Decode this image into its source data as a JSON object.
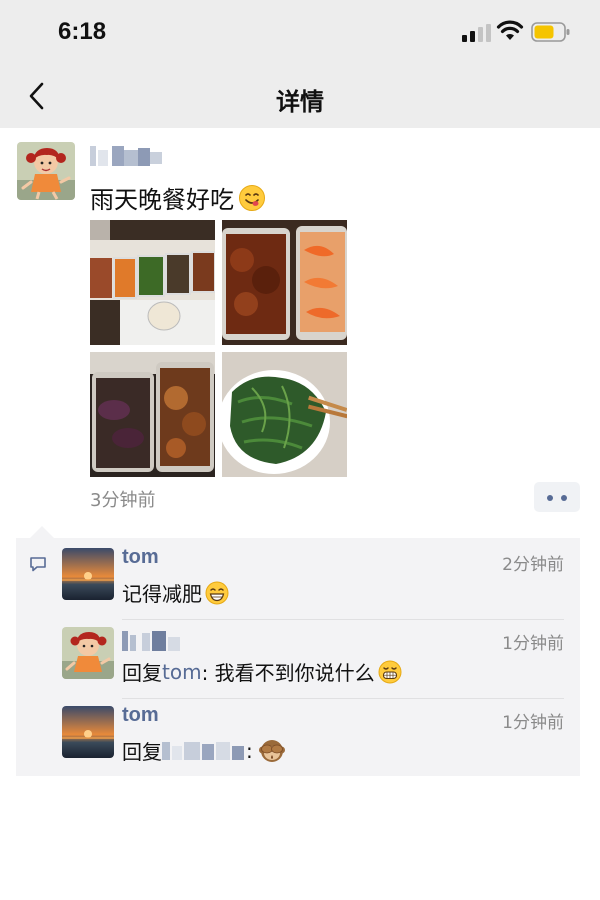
{
  "status_bar": {
    "time": "6:18"
  },
  "nav": {
    "title": "详情",
    "back_icon": "chevron-left-icon"
  },
  "post": {
    "text": "雨天晚餐好吃",
    "emoji": "yum-face",
    "time": "3分钟前",
    "photos": [
      "dinner-photo-1",
      "dinner-photo-2",
      "dinner-photo-3",
      "dinner-photo-4"
    ]
  },
  "comments": [
    {
      "name": "tom",
      "time": "2分钟前",
      "text": "记得减肥",
      "emoji": "grinning-face"
    },
    {
      "name": "",
      "time": "1分钟前",
      "reply_prefix": "回复",
      "reply_to": "tom",
      "text": ": 我看不到你说什么",
      "emoji": "grimacing-face"
    },
    {
      "name": "tom",
      "time": "1分钟前",
      "reply_prefix": "回复",
      "reply_to": "",
      "text": ":",
      "emoji": "see-no-evil-monkey"
    }
  ],
  "colors": {
    "link": "#576b95",
    "header_bg": "#ededed",
    "comment_bg": "#f3f3f5"
  }
}
